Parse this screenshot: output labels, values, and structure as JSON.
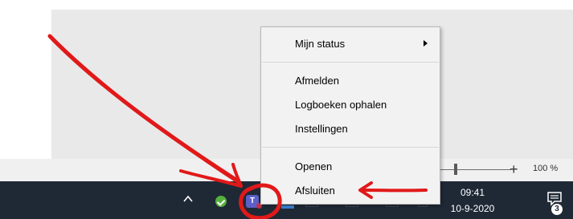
{
  "menu": {
    "items": [
      {
        "label": "Mijn status",
        "has_submenu": true
      },
      {
        "label": "Afmelden"
      },
      {
        "label": "Logboeken ophalen"
      },
      {
        "label": "Instellingen"
      },
      {
        "label": "Openen"
      },
      {
        "label": "Afsluiten"
      }
    ]
  },
  "zoom": {
    "plus": "+",
    "level": "100 %"
  },
  "taskbar": {
    "time": "09:41",
    "date": "10-9-2020",
    "notifications": "3",
    "teams_letter": "T",
    "icons": [
      "chevron-up-icon",
      "green-check-icon",
      "teams-icon",
      "notification-center-icon"
    ]
  },
  "colors": {
    "taskbar": "#1f2936",
    "menu_bg": "#f2f2f2",
    "annotation_red": "#e11919"
  }
}
